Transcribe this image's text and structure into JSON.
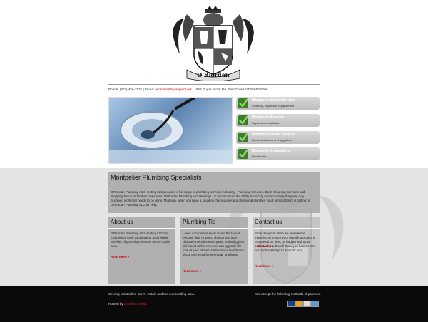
{
  "header": {
    "logo_text": "O'Riordan",
    "info_phone": "Phone: (802) 456-7031",
    "info_sep1": " | Email: ",
    "info_email": "oriordan@myfairpoint.net",
    "info_address": " | 1552 Dugar Brook Rd, East Calais VT 05650-8056"
  },
  "services": [
    {
      "title": "Montpelier Sewer Service",
      "sub": "Cleaning, repair and replacement"
    },
    {
      "title": "Montpelier Faucets",
      "sub": "Repair and installation"
    },
    {
      "title": "Montpelier Water Heaters",
      "sub": "New installations and upgrades"
    },
    {
      "title": "Montpelier Inspections",
      "sub": "Residential"
    }
  ],
  "specialists": {
    "heading": "Montpelier Plumbing Specialists",
    "body": "O'Riordan Plumbing and Heating LLC provides a full range of plumbing services including - Plumbing Services, Drain Cleaning Services and Repiping Services for the Calais area. O'Riordan Plumbing and Heating LLC has acquired the ability to quickly and accurately diagnose any plumbing work that needs to be done. That way, when you have a situation that requires a professional plumber, you'll feel confident in calling on O'Riordan Plumbing LLC for help."
  },
  "about": {
    "heading": "About us",
    "body": "O'Riordan Plumbing and Heating LLC has established itself as a leading and reliable provider of plumbing services for the Calais area.",
    "more": "Read more »"
  },
  "tip": {
    "heading": "Plumbing Tip",
    "body": "Leaks occur when seals inside the faucet become dirty or worn. Though you may choose to replace worn parts, replacing your old faucet with a new one can upgrade the look of your kitchen, bathroom or laundroom decor and avoid further repair problems.",
    "more": "Read more »"
  },
  "contact": {
    "heading": "Contact us",
    "body_a": "From design to finish we provide the expertise to ensure your plumbing project is completed on time, on budget and up to code. ",
    "link": "Contact us",
    "body_b": " today and we'll show you how we can put our knowledge to work for you.",
    "more": "Read more »"
  },
  "footer": {
    "serving": "Serving Montpelier, Barre, Calais and the surrounding area.",
    "hosted_prefix": "Hosted by ",
    "hosted_by": "Limitless Media",
    "payment": "We accept the following methods of payment"
  },
  "colors": {
    "accent_red": "#cc0000",
    "panel_gray": "#aaaaaa",
    "check_green": "#3b7d2a",
    "footer_bg": "#0a0a0a"
  },
  "payment_icons": [
    "visa-icon",
    "mastercard-icon",
    "discover-icon",
    "amex-icon"
  ]
}
